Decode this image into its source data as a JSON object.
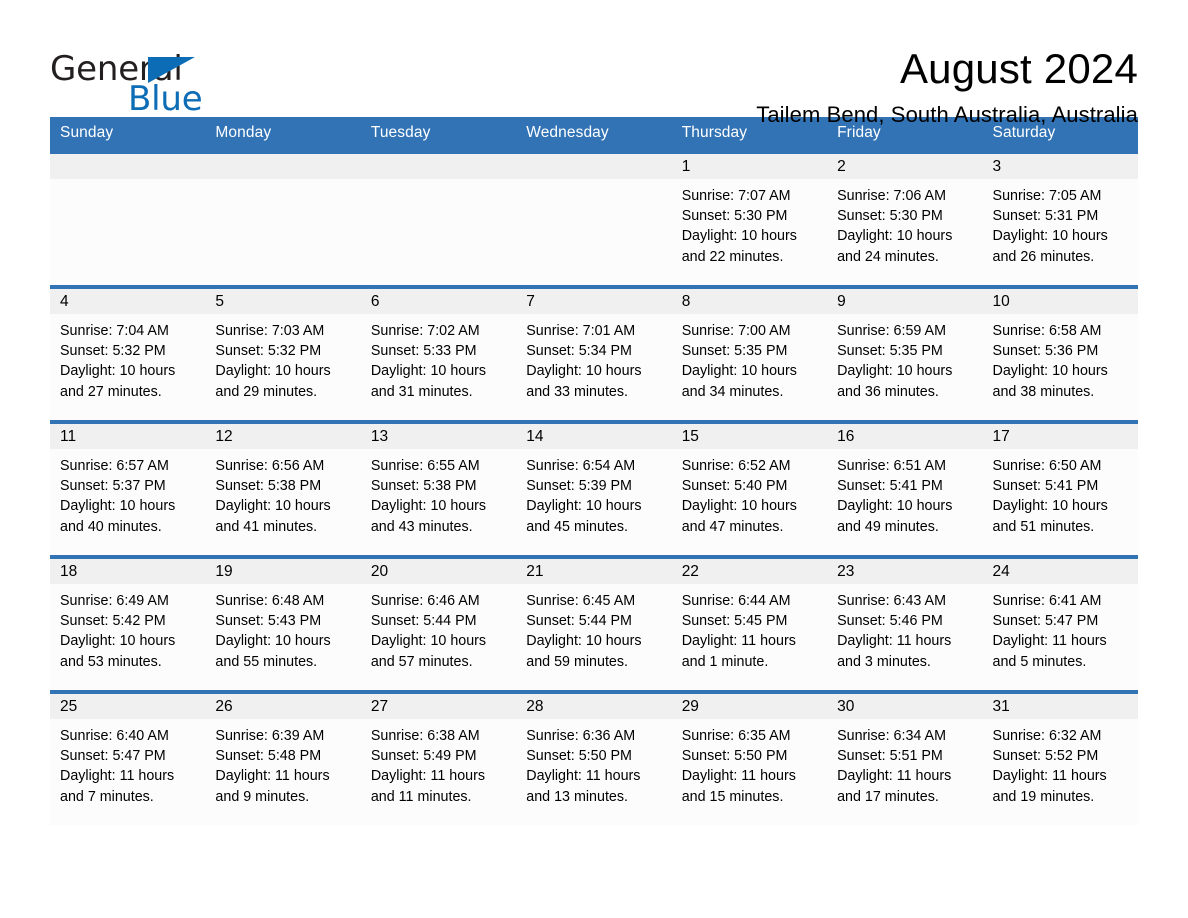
{
  "logo": {
    "word_general": "General",
    "word_blue": "Blue",
    "flag_color": "#0c6cb5"
  },
  "header": {
    "title": "August 2024",
    "location": "Tailem Bend, South Australia, Australia",
    "accent_color": "#3173b5",
    "daynum_band_color": "#f0f0f0"
  },
  "calendar": {
    "weekdays": [
      "Sunday",
      "Monday",
      "Tuesday",
      "Wednesday",
      "Thursday",
      "Friday",
      "Saturday"
    ],
    "weeks": [
      [
        {
          "day": "",
          "details": ""
        },
        {
          "day": "",
          "details": ""
        },
        {
          "day": "",
          "details": ""
        },
        {
          "day": "",
          "details": ""
        },
        {
          "day": "1",
          "details": "Sunrise: 7:07 AM\nSunset: 5:30 PM\nDaylight: 10 hours and 22 minutes."
        },
        {
          "day": "2",
          "details": "Sunrise: 7:06 AM\nSunset: 5:30 PM\nDaylight: 10 hours and 24 minutes."
        },
        {
          "day": "3",
          "details": "Sunrise: 7:05 AM\nSunset: 5:31 PM\nDaylight: 10 hours and 26 minutes."
        }
      ],
      [
        {
          "day": "4",
          "details": "Sunrise: 7:04 AM\nSunset: 5:32 PM\nDaylight: 10 hours and 27 minutes."
        },
        {
          "day": "5",
          "details": "Sunrise: 7:03 AM\nSunset: 5:32 PM\nDaylight: 10 hours and 29 minutes."
        },
        {
          "day": "6",
          "details": "Sunrise: 7:02 AM\nSunset: 5:33 PM\nDaylight: 10 hours and 31 minutes."
        },
        {
          "day": "7",
          "details": "Sunrise: 7:01 AM\nSunset: 5:34 PM\nDaylight: 10 hours and 33 minutes."
        },
        {
          "day": "8",
          "details": "Sunrise: 7:00 AM\nSunset: 5:35 PM\nDaylight: 10 hours and 34 minutes."
        },
        {
          "day": "9",
          "details": "Sunrise: 6:59 AM\nSunset: 5:35 PM\nDaylight: 10 hours and 36 minutes."
        },
        {
          "day": "10",
          "details": "Sunrise: 6:58 AM\nSunset: 5:36 PM\nDaylight: 10 hours and 38 minutes."
        }
      ],
      [
        {
          "day": "11",
          "details": "Sunrise: 6:57 AM\nSunset: 5:37 PM\nDaylight: 10 hours and 40 minutes."
        },
        {
          "day": "12",
          "details": "Sunrise: 6:56 AM\nSunset: 5:38 PM\nDaylight: 10 hours and 41 minutes."
        },
        {
          "day": "13",
          "details": "Sunrise: 6:55 AM\nSunset: 5:38 PM\nDaylight: 10 hours and 43 minutes."
        },
        {
          "day": "14",
          "details": "Sunrise: 6:54 AM\nSunset: 5:39 PM\nDaylight: 10 hours and 45 minutes."
        },
        {
          "day": "15",
          "details": "Sunrise: 6:52 AM\nSunset: 5:40 PM\nDaylight: 10 hours and 47 minutes."
        },
        {
          "day": "16",
          "details": "Sunrise: 6:51 AM\nSunset: 5:41 PM\nDaylight: 10 hours and 49 minutes."
        },
        {
          "day": "17",
          "details": "Sunrise: 6:50 AM\nSunset: 5:41 PM\nDaylight: 10 hours and 51 minutes."
        }
      ],
      [
        {
          "day": "18",
          "details": "Sunrise: 6:49 AM\nSunset: 5:42 PM\nDaylight: 10 hours and 53 minutes."
        },
        {
          "day": "19",
          "details": "Sunrise: 6:48 AM\nSunset: 5:43 PM\nDaylight: 10 hours and 55 minutes."
        },
        {
          "day": "20",
          "details": "Sunrise: 6:46 AM\nSunset: 5:44 PM\nDaylight: 10 hours and 57 minutes."
        },
        {
          "day": "21",
          "details": "Sunrise: 6:45 AM\nSunset: 5:44 PM\nDaylight: 10 hours and 59 minutes."
        },
        {
          "day": "22",
          "details": "Sunrise: 6:44 AM\nSunset: 5:45 PM\nDaylight: 11 hours and 1 minute."
        },
        {
          "day": "23",
          "details": "Sunrise: 6:43 AM\nSunset: 5:46 PM\nDaylight: 11 hours and 3 minutes."
        },
        {
          "day": "24",
          "details": "Sunrise: 6:41 AM\nSunset: 5:47 PM\nDaylight: 11 hours and 5 minutes."
        }
      ],
      [
        {
          "day": "25",
          "details": "Sunrise: 6:40 AM\nSunset: 5:47 PM\nDaylight: 11 hours and 7 minutes."
        },
        {
          "day": "26",
          "details": "Sunrise: 6:39 AM\nSunset: 5:48 PM\nDaylight: 11 hours and 9 minutes."
        },
        {
          "day": "27",
          "details": "Sunrise: 6:38 AM\nSunset: 5:49 PM\nDaylight: 11 hours and 11 minutes."
        },
        {
          "day": "28",
          "details": "Sunrise: 6:36 AM\nSunset: 5:50 PM\nDaylight: 11 hours and 13 minutes."
        },
        {
          "day": "29",
          "details": "Sunrise: 6:35 AM\nSunset: 5:50 PM\nDaylight: 11 hours and 15 minutes."
        },
        {
          "day": "30",
          "details": "Sunrise: 6:34 AM\nSunset: 5:51 PM\nDaylight: 11 hours and 17 minutes."
        },
        {
          "day": "31",
          "details": "Sunrise: 6:32 AM\nSunset: 5:52 PM\nDaylight: 11 hours and 19 minutes."
        }
      ]
    ]
  }
}
